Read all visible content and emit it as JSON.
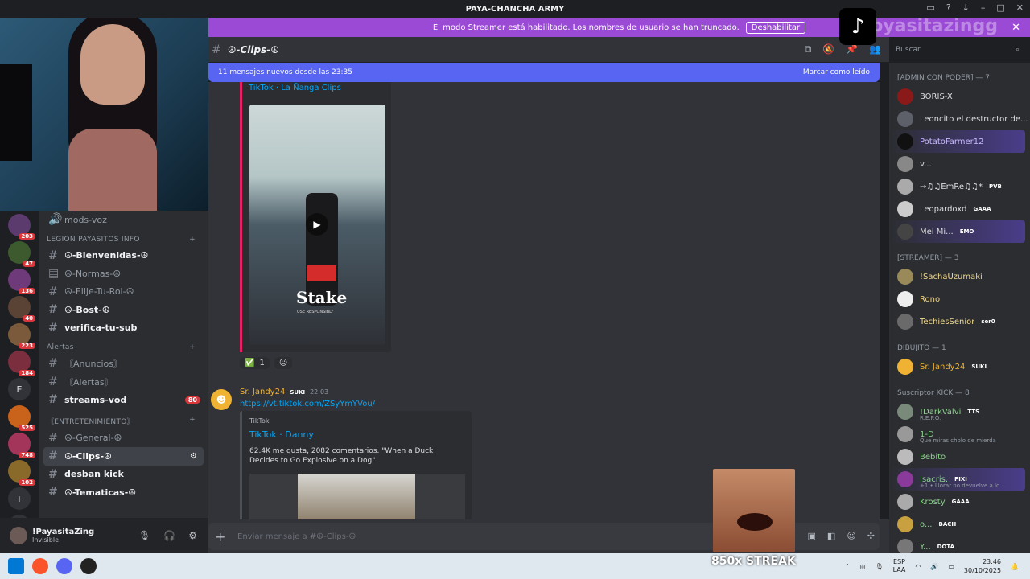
{
  "window": {
    "title": "PAYA-CHANCHA ARMY"
  },
  "banner": {
    "text": "El modo Streamer está habilitado. Los nombres de usuario se han truncado.",
    "button": "Deshabilitar",
    "watermark": "pyasitazingg"
  },
  "channel_header": {
    "name": "☮-Clips-☮",
    "search_placeholder": "Buscar"
  },
  "new_messages": {
    "text": "11 mensajes nuevos desde las 23:35",
    "mark_read": "Marcar como leído"
  },
  "servers": [
    {
      "badge": "203"
    },
    {
      "badge": "47"
    },
    {
      "badge": "136"
    },
    {
      "badge": "40"
    },
    {
      "badge": "223"
    },
    {
      "badge": "184"
    },
    {
      "letter": "E"
    },
    {
      "badge": "525"
    },
    {
      "badge": "748"
    },
    {
      "badge": "102"
    }
  ],
  "channels": {
    "top": {
      "name": "mods-voz"
    },
    "cat1": "LEGION PAYASITOS INFO",
    "cat1_items": [
      {
        "name": "☮-Bienvenidas-☮"
      },
      {
        "name": "☮-Normas-☮"
      },
      {
        "name": "☮-Elije-Tu-Rol-☮"
      },
      {
        "name": "☮-Bost-☮"
      },
      {
        "name": "verifica-tu-sub"
      }
    ],
    "cat2": "Alertas",
    "cat2_items": [
      {
        "name": "〘Anuncios〙"
      },
      {
        "name": "〘Alertas〙"
      },
      {
        "name": "streams-vod",
        "count": "80"
      }
    ],
    "cat3": "〘ENTRETENIMIENTO〙",
    "cat3_items": [
      {
        "name": "☮-General-☮"
      },
      {
        "name": "☮-Clips-☮"
      },
      {
        "name": "desban kick"
      },
      {
        "name": "☮-Tematicas-☮"
      }
    ]
  },
  "user": {
    "name": "!PayasitaZing",
    "status": "Invisible"
  },
  "embed1": {
    "provider": "TikTok · La Ñanga Clips",
    "stake": "Stake",
    "stake_sub": "USE RESPONSIBLY",
    "reaction_count": "1"
  },
  "message2": {
    "author": "Sr. Jandy24",
    "tag": "SUKI",
    "time": "22:03",
    "link": "https://vt.tiktok.com/ZSyYmYVou/"
  },
  "embed2": {
    "provider": "TikTok",
    "title": "TikTok · Danny",
    "desc": "62.4K me gusta, 2082 comentarios. \"When a Duck Decides to Go Explosive on a Dog\""
  },
  "composer": {
    "placeholder": "Enviar mensaje a #☮-Clips-☮"
  },
  "overlay": {
    "streak": "850x STREAK"
  },
  "members": {
    "cat_admin": "[ADMIN CON PODER] — 7",
    "admin": [
      {
        "name": "BORIS-X"
      },
      {
        "name": "Leoncito el destructor de..."
      },
      {
        "name": "PotatoFarmer12"
      },
      {
        "name": "v..."
      },
      {
        "name": "→♫♫EmRe♫♫*",
        "tag": "PVB"
      },
      {
        "name": "Leopardoxd",
        "tag": "GAAA"
      },
      {
        "name": "Mei Mi...",
        "tag": "EMO"
      }
    ],
    "cat_streamer": "[STREAMER] — 3",
    "streamer": [
      {
        "name": "!SachaUzumaki"
      },
      {
        "name": "Rono"
      },
      {
        "name": "TechiesSenior",
        "tag": "ser0"
      }
    ],
    "cat_dibujito": "DIBUJITO — 1",
    "dibujito": [
      {
        "name": "Sr. Jandy24",
        "tag": "SUKI"
      }
    ],
    "cat_kick": "Suscriptor KICK — 8",
    "kick": [
      {
        "name": "!DarkValvi",
        "tag": "TTS",
        "sub": "R.E.P.O."
      },
      {
        "name": "1-D",
        "sub": "Que miras cholo de mierda"
      },
      {
        "name": "Bebito"
      },
      {
        "name": "Isacris.",
        "tag": "PIXI",
        "sub": "+1 • Llorar no devuelve a lo..."
      },
      {
        "name": "Krosty",
        "tag": "GAAA"
      },
      {
        "name": "o...",
        "tag": "BACH"
      },
      {
        "name": "Y...",
        "tag": "DOTA"
      }
    ]
  },
  "tray": {
    "lang": "ESP",
    "layout": "LAA",
    "time": "23:46",
    "date": "30/10/2025"
  }
}
